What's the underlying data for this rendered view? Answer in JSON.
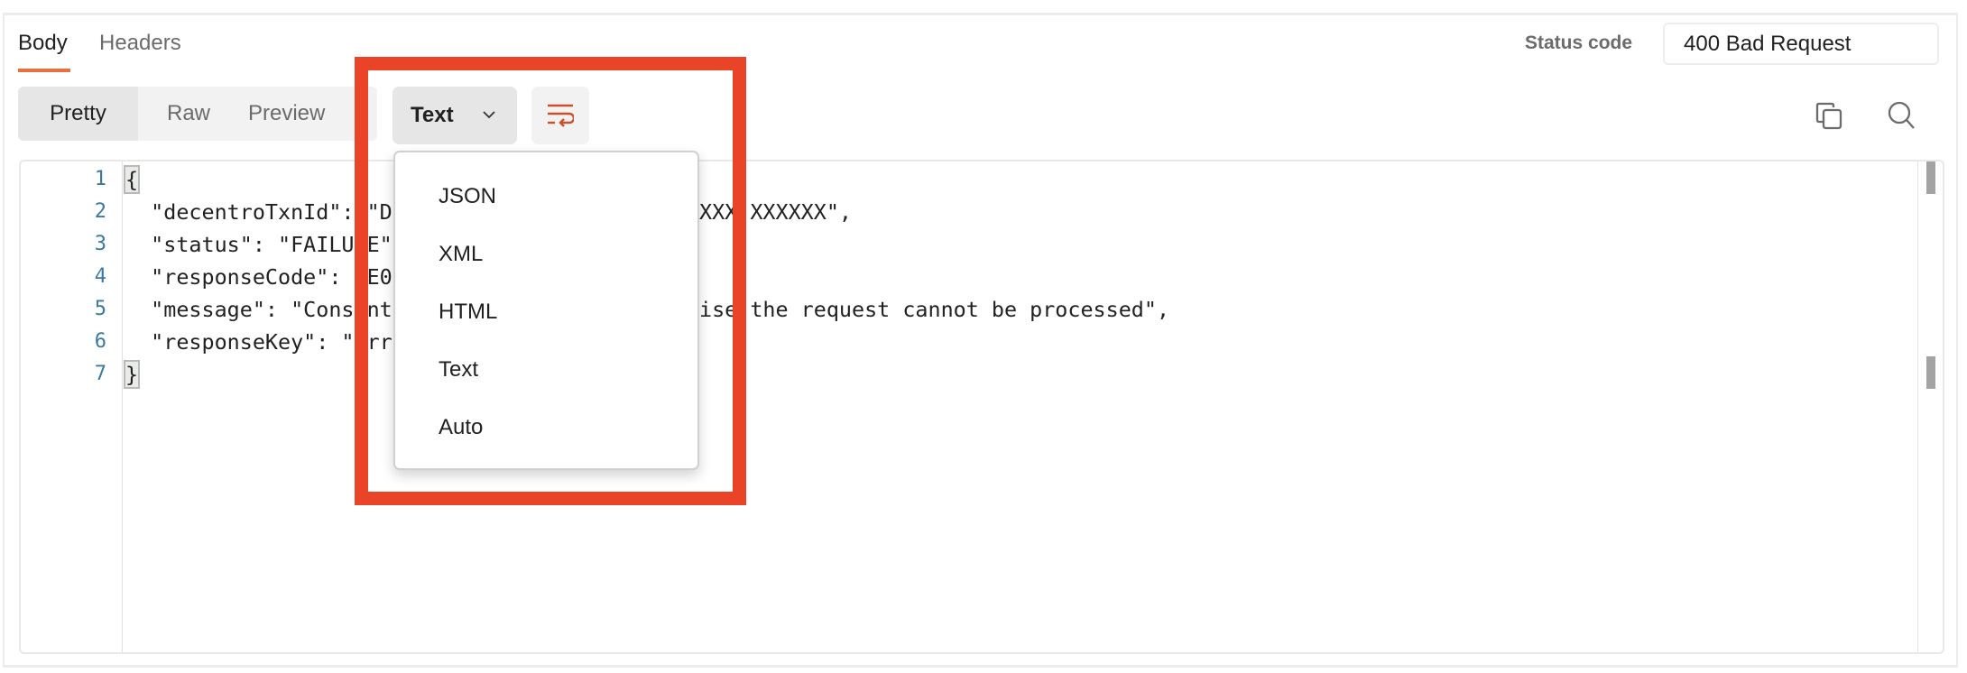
{
  "tabs": {
    "body": "Body",
    "headers": "Headers",
    "active": "Body",
    "accent_color": "#e8703f"
  },
  "status": {
    "label": "Status code",
    "value": "400 Bad Request"
  },
  "view_modes": {
    "items": [
      "Pretty",
      "Raw",
      "Preview"
    ],
    "active": "Pretty"
  },
  "language_select": {
    "selected": "Text",
    "icon": "chevron-down-icon",
    "options": [
      "JSON",
      "XML",
      "HTML",
      "Text",
      "Auto"
    ]
  },
  "toolbar": {
    "wrap_icon": "wrap-lines-icon",
    "copy_icon": "copy-icon",
    "search_icon": "search-icon"
  },
  "code": {
    "line_numbers": [
      "1",
      "2",
      "3",
      "4",
      "5",
      "6",
      "7"
    ],
    "lines": [
      {
        "left": "{",
        "right": ""
      },
      {
        "left": "  \"decentroTxnId\": \"D",
        "right": "XXX XXXXXX\","
      },
      {
        "left": "  \"status\": \"FAILU E\"",
        "right": ""
      },
      {
        "left": "  \"responseCode\":  E0",
        "right": ""
      },
      {
        "left": "  \"message\": \"Cons nt",
        "right": "ise the request cannot be processed\","
      },
      {
        "left": "  \"responseKey\": \" rr",
        "right": ""
      },
      {
        "left": "}",
        "right": ""
      }
    ]
  },
  "annotation": {
    "color": "#e94328"
  }
}
